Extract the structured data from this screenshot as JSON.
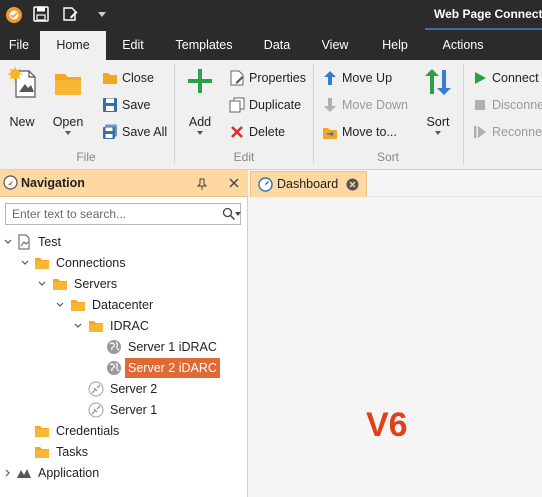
{
  "window": {
    "title": "Web Page Connecti"
  },
  "menu": {
    "tabs": [
      {
        "label": "File"
      },
      {
        "label": "Home"
      },
      {
        "label": "Edit"
      },
      {
        "label": "Templates"
      },
      {
        "label": "Data"
      },
      {
        "label": "View"
      },
      {
        "label": "Help"
      },
      {
        "label": "Actions"
      }
    ],
    "active": "Home"
  },
  "ribbon": {
    "file_group": {
      "label": "File",
      "new": "New",
      "open": "Open",
      "close": "Close",
      "save": "Save",
      "save_all": "Save All"
    },
    "edit_group": {
      "label": "Edit",
      "add": "Add",
      "properties": "Properties",
      "duplicate": "Duplicate",
      "delete": "Delete"
    },
    "sort_group": {
      "label": "Sort",
      "move_up": "Move Up",
      "move_down": "Move Down",
      "move_to": "Move to...",
      "sort": "Sort"
    },
    "connection_group": {
      "connect": "Connect",
      "disconnect": "Disconne",
      "reconnect": "Reconne"
    }
  },
  "navigation": {
    "title": "Navigation",
    "search_placeholder": "Enter text to search...",
    "tree": [
      {
        "label": "Test"
      },
      {
        "label": "Connections"
      },
      {
        "label": "Servers"
      },
      {
        "label": "Datacenter"
      },
      {
        "label": "IDRAC"
      },
      {
        "label": "Server 1 iDRAC"
      },
      {
        "label": "Server 2 iDARC",
        "selected": true
      },
      {
        "label": "Server 2"
      },
      {
        "label": "Server 1"
      },
      {
        "label": "Credentials"
      },
      {
        "label": "Tasks"
      },
      {
        "label": "Application"
      }
    ]
  },
  "document": {
    "tab_label": "Dashboard",
    "watermark": "V6"
  },
  "colors": {
    "accent_orange": "#e06a35",
    "header_orange": "#fdd8a0",
    "titlebar": "#2b2b2b",
    "watermark_red": "#e0401b"
  }
}
